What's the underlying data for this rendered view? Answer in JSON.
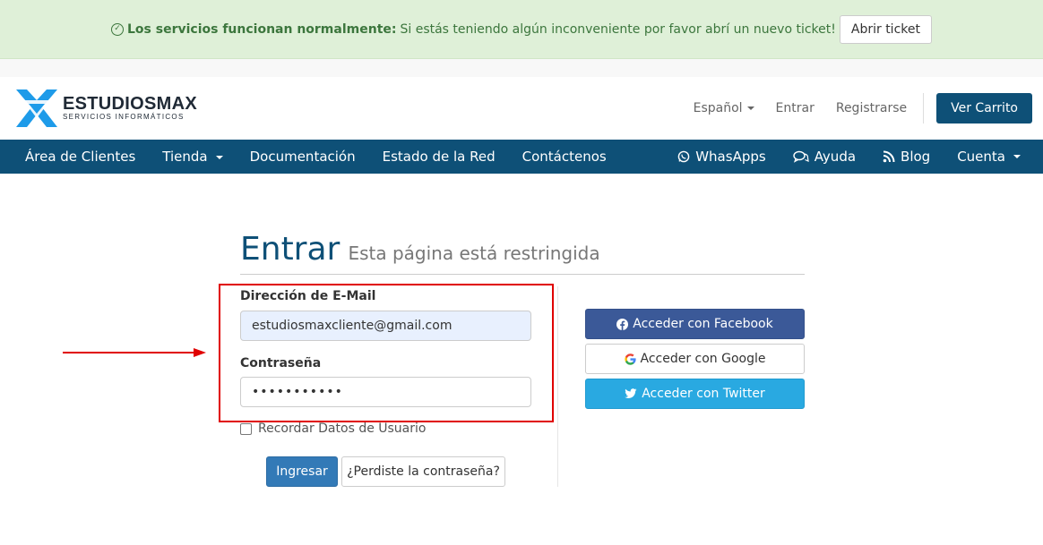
{
  "alert": {
    "strong": "Los servicios funcionan normalmente:",
    "text": "Si estás teniendo algún inconveniente por favor abrí un nuevo ticket!",
    "button": "Abrir ticket"
  },
  "brand": {
    "name": "ESTUDIOSMAX",
    "tagline": "SERVICIOS INFORMÁTICOS",
    "color": "#1e9be9"
  },
  "header": {
    "language": "Español",
    "login": "Entrar",
    "register": "Registrarse",
    "cart": "Ver Carrito"
  },
  "nav": {
    "left": [
      "Área de Clientes",
      "Tienda",
      "Documentación",
      "Estado de la Red",
      "Contáctenos"
    ],
    "right": {
      "whatsapp": "WhasApps",
      "help": "Ayuda",
      "blog": "Blog",
      "account": "Cuenta"
    },
    "color": "#0e5077"
  },
  "page": {
    "title": "Entrar",
    "subtitle": "Esta página está restringida"
  },
  "form": {
    "email_label": "Dirección de E-Mail",
    "email_value": "estudiosmaxcliente@gmail.com",
    "password_label": "Contraseña",
    "password_value": "•••••••••••",
    "remember_label": "Recordar Datos de Usuario",
    "submit": "Ingresar",
    "forgot": "¿Perdiste la contraseña?"
  },
  "social": {
    "facebook": "Acceder con Facebook",
    "google": "Acceder con Google",
    "twitter": "Acceder con Twitter"
  },
  "annotation_color": "#e00000"
}
